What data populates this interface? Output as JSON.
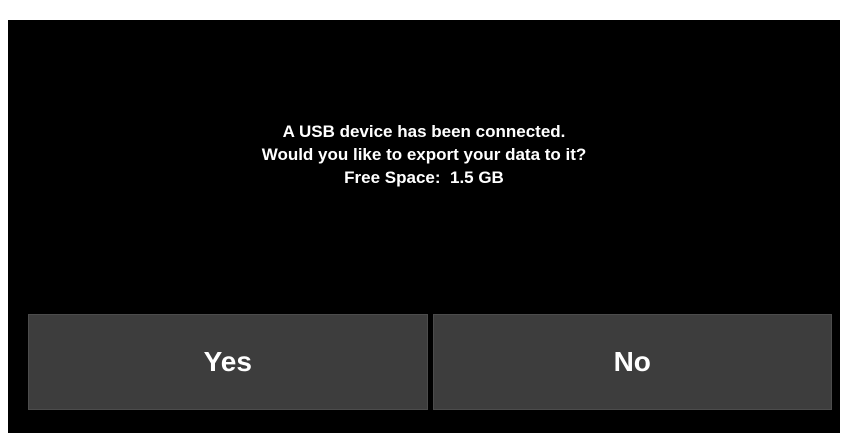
{
  "dialog": {
    "message_line_1": "A USB device has been connected.",
    "message_line_2": "Would you like to export your data to it?",
    "message_line_3": "Free Space:  1.5 GB"
  },
  "buttons": {
    "yes_label": "Yes",
    "no_label": "No"
  },
  "colors": {
    "background": "#000000",
    "button_fill": "#3d3d3d",
    "text": "#ffffff"
  }
}
